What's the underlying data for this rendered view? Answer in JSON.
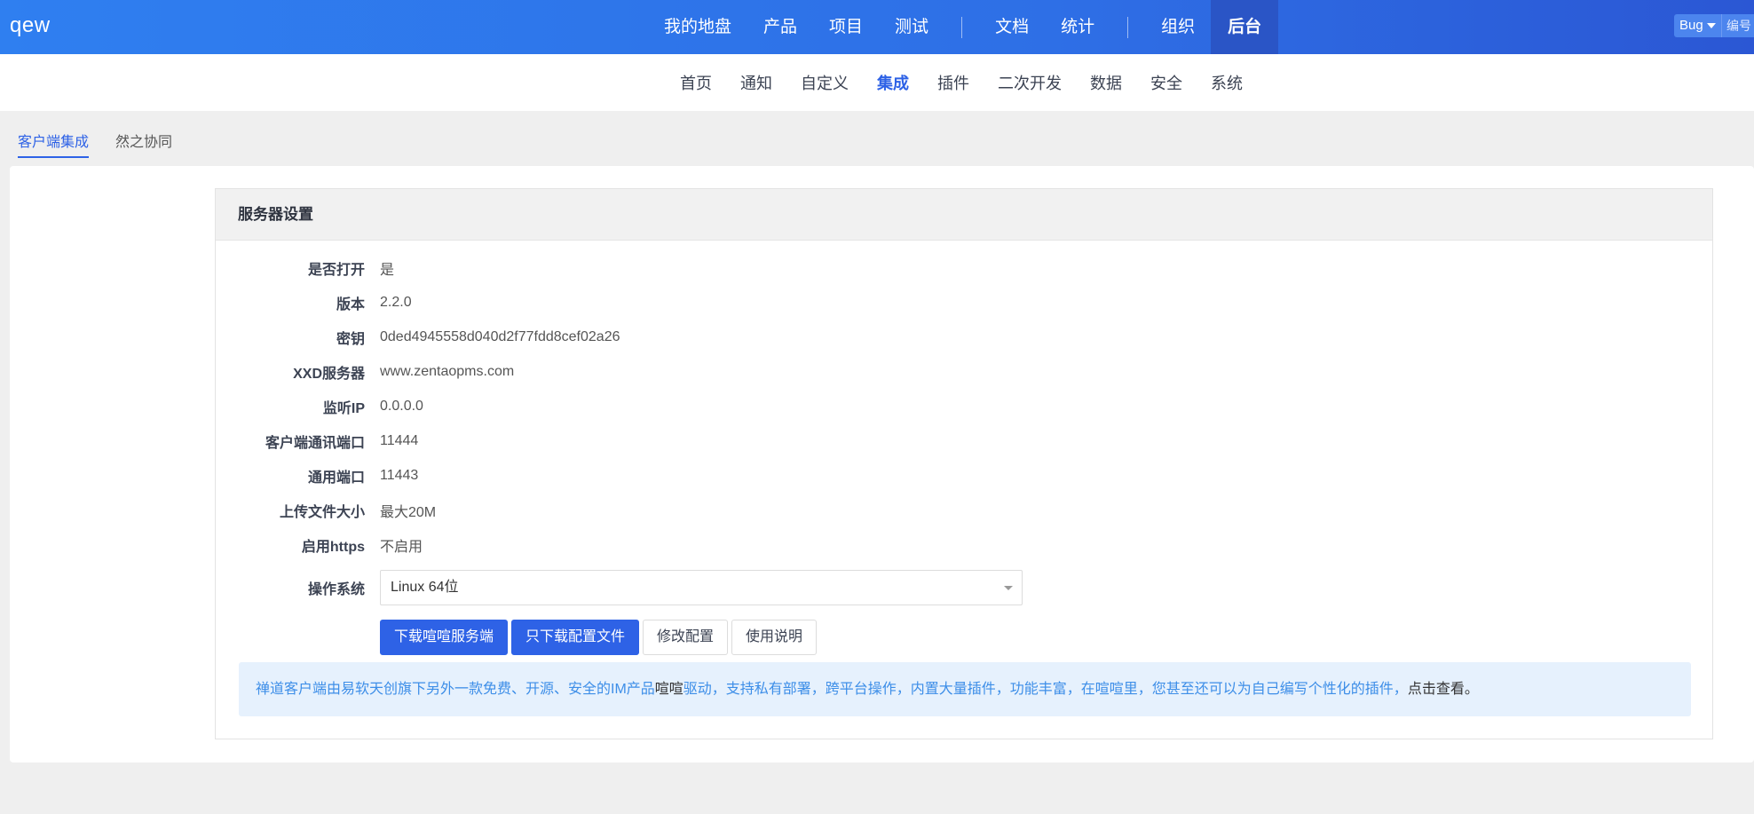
{
  "app": {
    "title": "qew"
  },
  "main_nav": {
    "items": [
      "我的地盘",
      "产品",
      "项目",
      "测试",
      "文档",
      "统计",
      "组织",
      "后台"
    ],
    "active": "后台"
  },
  "search": {
    "type_label": "Bug",
    "placeholder": "编号"
  },
  "sub_nav": {
    "items": [
      "首页",
      "通知",
      "自定义",
      "集成",
      "插件",
      "二次开发",
      "数据",
      "安全",
      "系统"
    ],
    "active": "集成"
  },
  "tabs": {
    "items": [
      "客户端集成",
      "然之协同"
    ],
    "active": "客户端集成"
  },
  "panel": {
    "title": "服务器设置",
    "fields": [
      {
        "label": "是否打开",
        "value": "是"
      },
      {
        "label": "版本",
        "value": "2.2.0"
      },
      {
        "label": "密钥",
        "value": "0ded4945558d040d2f77fdd8cef02a26"
      },
      {
        "label": "XXD服务器",
        "value": "www.zentaopms.com"
      },
      {
        "label": "监听IP",
        "value": "0.0.0.0"
      },
      {
        "label": "客户端通讯端口",
        "value": "11444"
      },
      {
        "label": "通用端口",
        "value": "11443"
      },
      {
        "label": "上传文件大小",
        "value": "最大20M"
      },
      {
        "label": "启用https",
        "value": "不启用"
      }
    ],
    "os": {
      "label": "操作系统",
      "selected": "Linux 64位"
    },
    "buttons": {
      "download_server": "下载喧喧服务端",
      "download_config": "只下载配置文件",
      "edit_config": "修改配置",
      "manual": "使用说明"
    },
    "notice": {
      "part1": "禅道客户端由易软天创旗下另外一款免费、开源、安全的IM产品",
      "link1": "喧喧",
      "part2": "驱动，支持私有部署，跨平台操作，内置大量插件，功能丰富，在喧喧里，您甚至还可以为自己编写个性化的插件，",
      "link2": "点击查看",
      "end": "。"
    }
  },
  "colors": {
    "primary": "#2e62e6",
    "header_start": "#2f7ff0",
    "header_end": "#2b57d4",
    "notice_bg": "#e6f1fd"
  }
}
